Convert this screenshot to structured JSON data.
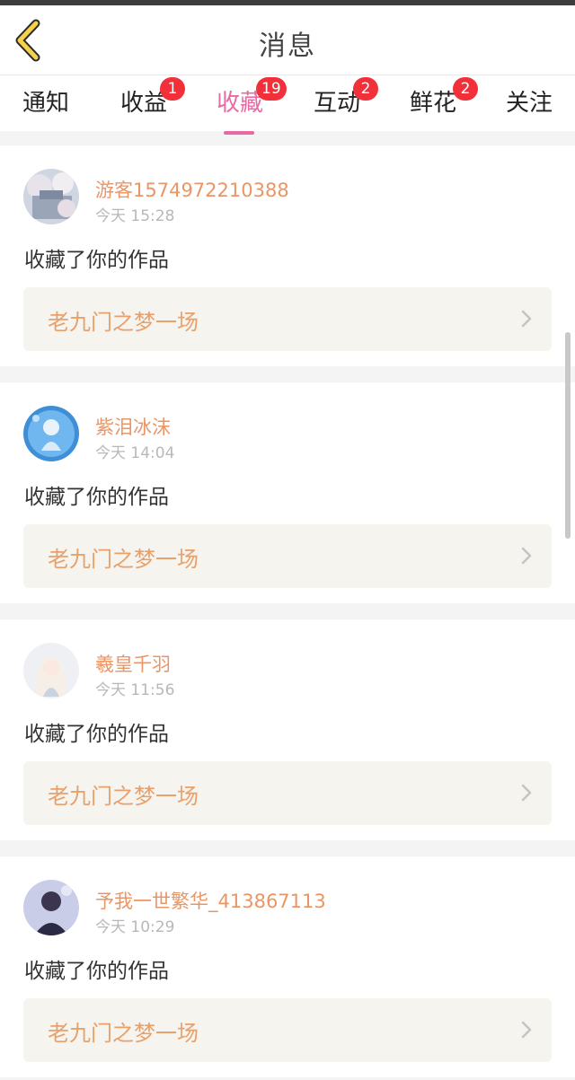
{
  "header": {
    "title": "消息"
  },
  "tabs": [
    {
      "label": "通知",
      "badge": ""
    },
    {
      "label": "收益",
      "badge": "1"
    },
    {
      "label": "收藏",
      "badge": "19",
      "active": true
    },
    {
      "label": "互动",
      "badge": "2"
    },
    {
      "label": "鲜花",
      "badge": "2"
    },
    {
      "label": "关注",
      "badge": ""
    }
  ],
  "feed": [
    {
      "username": "游客1574972210388",
      "time": "今天 15:28",
      "action": "收藏了你的作品",
      "work": "老九门之梦一场"
    },
    {
      "username": "紫泪冰沫",
      "time": "今天 14:04",
      "action": "收藏了你的作品",
      "work": "老九门之梦一场"
    },
    {
      "username": "羲皇千羽",
      "time": "今天 11:56",
      "action": "收藏了你的作品",
      "work": "老九门之梦一场"
    },
    {
      "username": "予我一世繁华_413867113",
      "time": "今天 10:29",
      "action": "收藏了你的作品",
      "work": "老九门之梦一场"
    }
  ],
  "colors": {
    "accent": "#e86aa3",
    "badge": "#f2303a",
    "username": "#e99666",
    "work_title": "#e8a06c"
  }
}
